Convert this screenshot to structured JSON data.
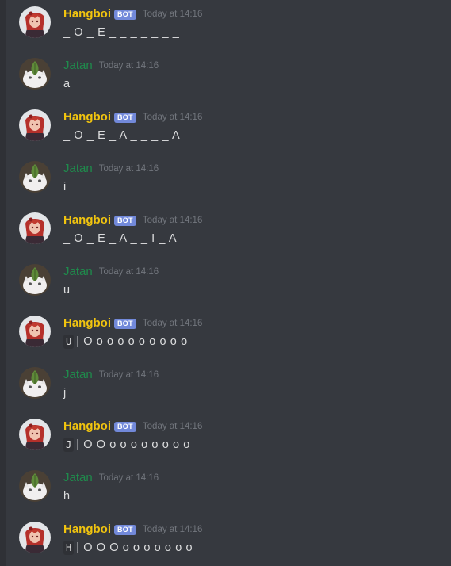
{
  "users": {
    "hangboi": {
      "name": "Hangboi",
      "badge": "BOT",
      "color": "#f1c40f",
      "avatar_icon": "red-haired-anime-avatar-icon"
    },
    "jatan": {
      "name": "Jatan",
      "color": "#1f8b4c",
      "avatar_icon": "white-cat-with-leaf-avatar-icon"
    }
  },
  "messages": [
    {
      "author": "Hangboi",
      "bot_badge": "BOT",
      "time": "Today at 14:16",
      "code": "",
      "text": "_ O _ E _ _ _ _ _ _ _"
    },
    {
      "author": "Jatan",
      "time": "Today at 14:16",
      "code": "",
      "text": "a"
    },
    {
      "author": "Hangboi",
      "bot_badge": "BOT",
      "time": "Today at 14:16",
      "code": "",
      "text": "_ O _ E _ A _ _ _ _ A"
    },
    {
      "author": "Jatan",
      "time": "Today at 14:16",
      "code": "",
      "text": "i"
    },
    {
      "author": "Hangboi",
      "bot_badge": "BOT",
      "time": "Today at 14:16",
      "code": "",
      "text": "_ O _ E _ A _ _ I _ A"
    },
    {
      "author": "Jatan",
      "time": "Today at 14:16",
      "code": "",
      "text": "u"
    },
    {
      "author": "Hangboi",
      "bot_badge": "BOT",
      "time": "Today at 14:16",
      "code": "U",
      "text": "| O o o o o o o o o o"
    },
    {
      "author": "Jatan",
      "time": "Today at 14:16",
      "code": "",
      "text": "j"
    },
    {
      "author": "Hangboi",
      "bot_badge": "BOT",
      "time": "Today at 14:16",
      "code": "J",
      "text": "| O O o o o o o o o o"
    },
    {
      "author": "Jatan",
      "time": "Today at 14:16",
      "code": "",
      "text": "h"
    },
    {
      "author": "Hangboi",
      "bot_badge": "BOT",
      "time": "Today at 14:16",
      "code": "H",
      "text": "| O O O o o o o o o o"
    }
  ]
}
